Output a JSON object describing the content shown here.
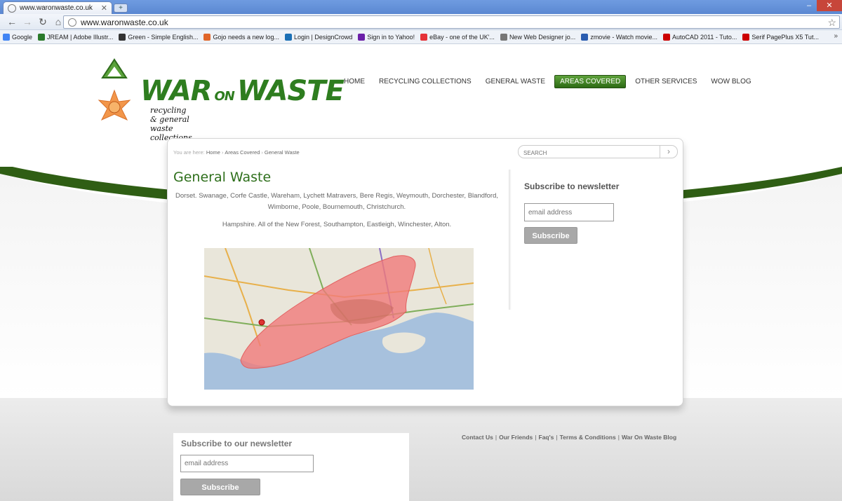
{
  "browser": {
    "tab_title": "www.waronwaste.co.uk",
    "new_tab": "+",
    "url": "www.waronwaste.co.uk",
    "bookmarks": [
      {
        "label": "Google",
        "color": "#4285f4"
      },
      {
        "label": "JREAM | Adobe Illustr...",
        "color": "#2a7a2a"
      },
      {
        "label": "Green - Simple English...",
        "color": "#333333"
      },
      {
        "label": "Gojo needs a new log...",
        "color": "#e0662a"
      },
      {
        "label": "Login | DesignCrowd",
        "color": "#1a6fb5"
      },
      {
        "label": "Sign in to Yahoo!",
        "color": "#6b1fa8"
      },
      {
        "label": "eBay - one of the UK'...",
        "color": "#e53238"
      },
      {
        "label": "New Web Designer jo...",
        "color": "#777777"
      },
      {
        "label": "zmovie - Watch movie...",
        "color": "#2a5db0"
      },
      {
        "label": "AutoCAD 2011 - Tuto...",
        "color": "#cc0000"
      },
      {
        "label": "Serif PagePlus X5 Tut...",
        "color": "#cc0000"
      }
    ],
    "more": "»"
  },
  "site": {
    "logo_word1": "WAR",
    "logo_on": "ON",
    "logo_word2": "WASTE",
    "tagline": "recycling & general waste collections",
    "nav": [
      "HOME",
      "RECYCLING COLLECTIONS",
      "GENERAL WASTE",
      "AREAS COVERED",
      "OTHER SERVICES",
      "WOW BLOG"
    ],
    "nav_active": "AREAS COVERED",
    "accent": "#2e7d1f"
  },
  "breadcrumb": {
    "prefix": "You are here:",
    "items": [
      "Home",
      "Areas Covered",
      "General Waste"
    ],
    "separator": "›"
  },
  "search": {
    "placeholder": "SEARCH"
  },
  "main": {
    "title": "General Waste",
    "areas_dorset": "Dorset. Swanage, Corfe Castle, Wareham, Lychett Matravers, Bere Regis, Weymouth, Dorchester, Blandford, Wimborne, Poole, Bournemouth, Christchurch.",
    "areas_hampshire": "Hampshire. All of the New Forest, Southampton, Eastleigh, Winchester, Alton."
  },
  "sidebar": {
    "newsletter_title": "Subscribe to newsletter",
    "email_placeholder": "email address",
    "subscribe": "Subscribe"
  },
  "footer": {
    "newsletter_title": "Subscribe to our newsletter",
    "email_placeholder": "email address",
    "subscribe": "Subscribe",
    "links": [
      "Contact Us",
      "Our Friends",
      "Faq's",
      "Terms & Conditions",
      "War On Waste Blog"
    ]
  }
}
